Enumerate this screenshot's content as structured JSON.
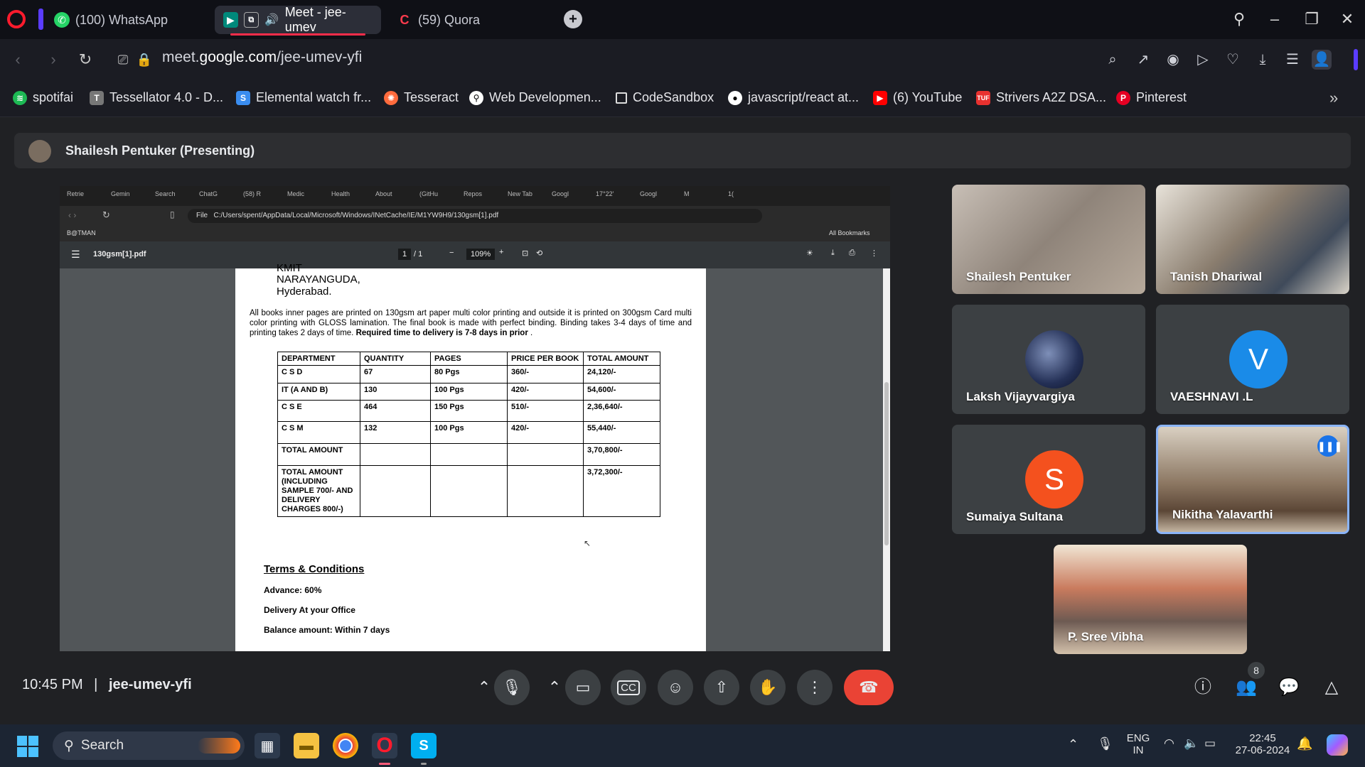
{
  "browser": {
    "tabs": [
      {
        "label": "(100) WhatsApp",
        "icon": "whatsapp-icon",
        "active": false
      },
      {
        "label": "Meet - jee-umev",
        "icon": "google-meet-icon",
        "active": true
      },
      {
        "label": "(59) Quora",
        "icon": "quora-icon",
        "active": false
      }
    ],
    "url_prefix": "meet.",
    "url_domain": "google.com",
    "url_path": "/jee-umev-yfi",
    "bookmarks": [
      {
        "label": "spotifai",
        "color": "#1db954"
      },
      {
        "label": "Tessellator 4.0 - D...",
        "color": "#888888"
      },
      {
        "label": "Elemental watch fr...",
        "color": "#3a8df0"
      },
      {
        "label": "Tesseract",
        "color": "#ff6b3d"
      },
      {
        "label": "Web Developmen...",
        "color": "#ffffff"
      },
      {
        "label": "CodeSandbox",
        "color": "#dddddd"
      },
      {
        "label": "javascript/react at...",
        "color": "#ffffff"
      },
      {
        "label": "(6) YouTube",
        "color": "#ff0000"
      },
      {
        "label": "Strivers A2Z DSA...",
        "color": "#e8312f"
      },
      {
        "label": "Pinterest",
        "color": "#e60023"
      }
    ]
  },
  "meet": {
    "presenter_label": "Shailesh Pentuker (Presenting)",
    "time": "10:45 PM",
    "separator": "|",
    "meeting_code": "jee-umev-yfi",
    "people_count": "8",
    "participants": [
      {
        "name": "Shailesh Pentuker",
        "type": "video"
      },
      {
        "name": "Tanish Dhariwal",
        "type": "video"
      },
      {
        "name": "Laksh Vijayvargiya",
        "type": "avatar"
      },
      {
        "name": "VAESHNAVI .L",
        "type": "initial",
        "initial": "V",
        "color": "#1a8be8"
      },
      {
        "name": "Sumaiya Sultana",
        "type": "initial",
        "initial": "S",
        "color": "#f4511e"
      },
      {
        "name": "Nikitha Yalavarthi",
        "type": "video"
      },
      {
        "name": "P. Sree Vibha",
        "type": "video"
      }
    ]
  },
  "shared_screen": {
    "tabs": [
      "Retrie",
      "Gemin",
      "Search",
      "ChatG",
      "(58) R",
      "Medic",
      "Health",
      "About",
      "(GitHu",
      "Repos",
      "New Tab",
      "Googl",
      "17°22'",
      "Googl",
      "M",
      "1("
    ],
    "file_label": "File",
    "file_path": "C:/Users/spent/AppData/Local/Microsoft/Windows/INetCache/IE/M1YW9H9/130gsm[1].pdf",
    "bookmark": "B@TMAN",
    "all_bookmarks": "All Bookmarks",
    "pdf_name": "130gsm[1].pdf",
    "page_current": "1",
    "page_total": "/ 1",
    "zoom": "109%",
    "doc": {
      "address_line_0": "KMIT",
      "address_line_1": "NARAYANGUDA,",
      "address_line_2": "Hyderabad.",
      "paragraph": "All books inner pages are printed on 130gsm art paper multi color printing and outside it is printed on 300gsm Card multi color printing with GLOSS lamination. The final book is made with perfect binding. Binding takes 3-4 days of time and printing takes 2 days of time. ",
      "paragraph_bold": "Required time to delivery is 7-8 days in prior",
      "paragraph_end": " .",
      "table_headers": [
        "DEPARTMENT",
        "QUANTITY",
        "PAGES",
        "PRICE PER BOOK",
        "TOTAL AMOUNT"
      ],
      "table_rows": [
        [
          "C S D",
          "67",
          "80 Pgs",
          "360/-",
          "24,120/-"
        ],
        [
          "IT (A AND B)",
          "130",
          "100 Pgs",
          "420/-",
          "54,600/-"
        ],
        [
          "C S E",
          "464",
          "150 Pgs",
          "510/-",
          "2,36,640/-"
        ],
        [
          "C S M",
          "132",
          "100 Pgs",
          "420/-",
          "55,440/-"
        ],
        [
          "TOTAL AMOUNT",
          "",
          "",
          "",
          "3,70,800/-"
        ],
        [
          "TOTAL AMOUNT (INCLUDING SAMPLE 700/- AND DELIVERY CHARGES 800/-)",
          "",
          "",
          "",
          "3,72,300/-"
        ]
      ],
      "terms_title": "Terms & Conditions",
      "advance": "Advance:  60%",
      "delivery": "Delivery  At your Office",
      "balance": "Balance amount: Within 7 days"
    }
  },
  "taskbar": {
    "search_label": "Search",
    "lang_line1": "ENG",
    "lang_line2": "IN",
    "time": "22:45",
    "date": "27-06-2024"
  }
}
